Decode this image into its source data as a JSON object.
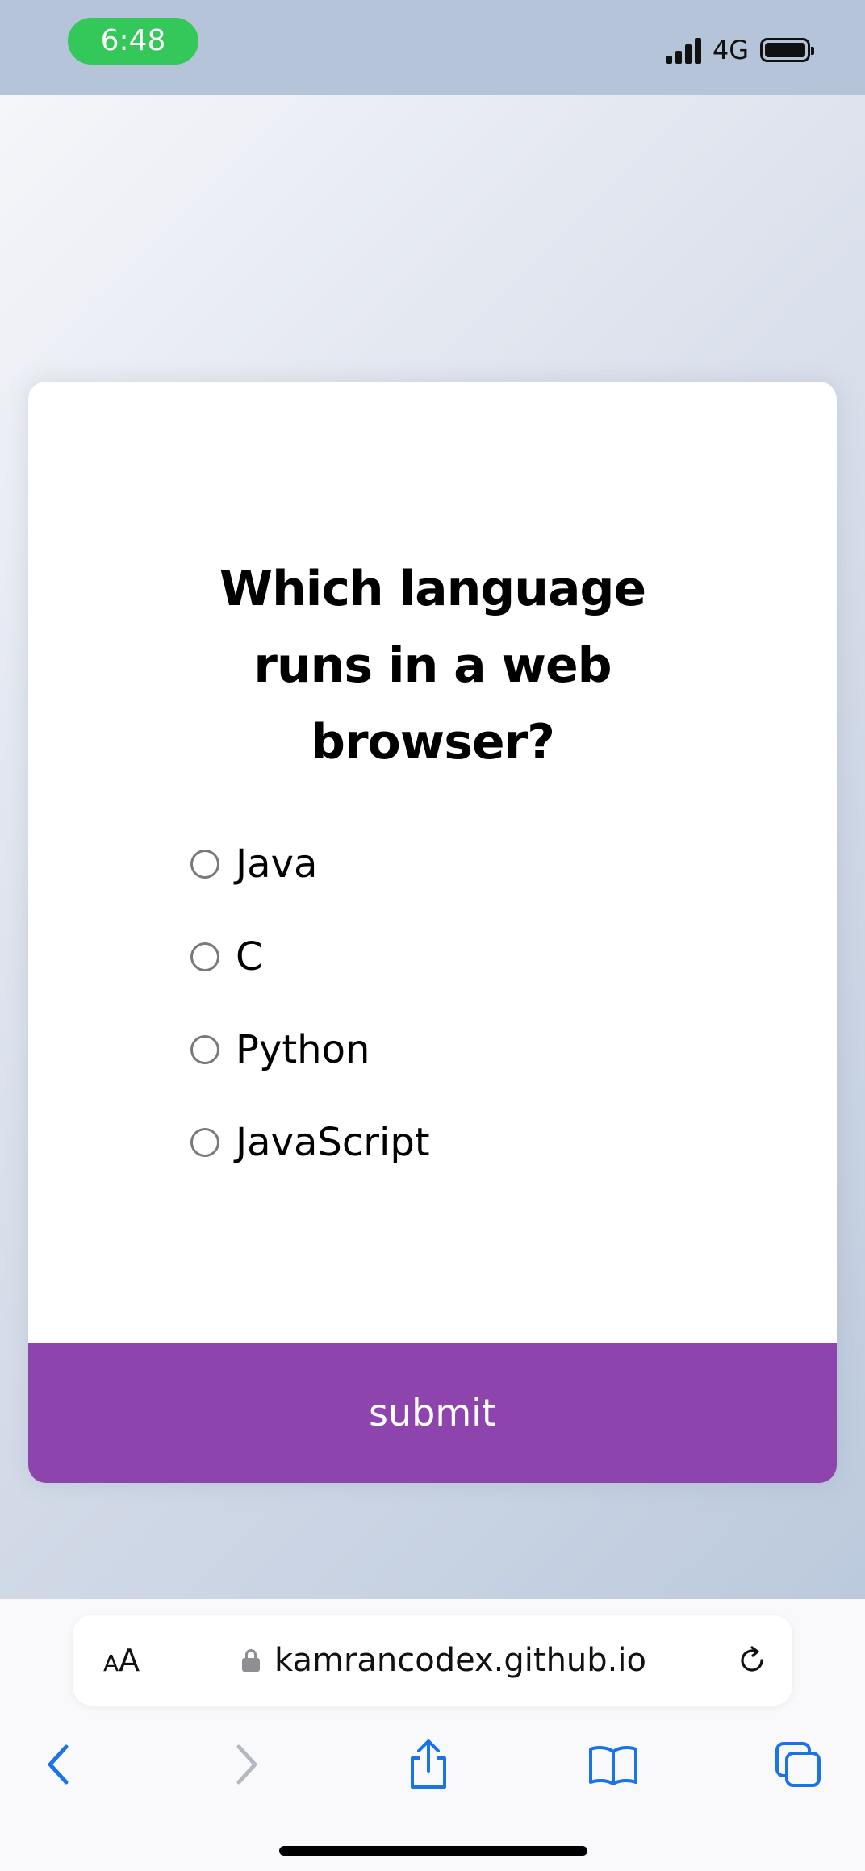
{
  "status_bar": {
    "time": "6:48",
    "network": "4G",
    "signal_icon": "signal-bars-icon",
    "battery_icon": "battery-full-icon"
  },
  "quiz": {
    "question": "Which language runs in a web browser?",
    "answers": [
      "Java",
      "C",
      "Python",
      "JavaScript"
    ],
    "selected": null,
    "submit_label": "submit",
    "accent_color": "#8e44ad"
  },
  "browser": {
    "text_size_label_small": "A",
    "text_size_label_large": "A",
    "url": "kamrancodex.github.io",
    "icons": [
      "back-icon",
      "forward-icon",
      "share-icon",
      "bookmarks-icon",
      "tabs-icon",
      "reload-icon",
      "lock-icon"
    ],
    "tint_color": "#1a73e8"
  }
}
